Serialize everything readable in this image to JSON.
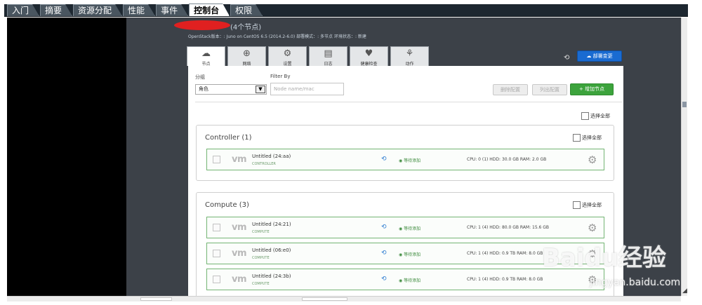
{
  "outer_tabs": [
    {
      "label": "入门"
    },
    {
      "label": "摘要"
    },
    {
      "label": "资源分配"
    },
    {
      "label": "性能"
    },
    {
      "label": "事件"
    },
    {
      "label": "控制台",
      "active": true
    },
    {
      "label": "权限"
    }
  ],
  "header": {
    "title_suffix": "(4个节点)",
    "info": "OpenStack版本：: Juno on CentOS 6.5 (2014.2-6.0)   部署模式：: 多节点   环境状态：: 新建",
    "deploy_button": "部署变更"
  },
  "icon_tabs": [
    {
      "label": "节点",
      "icon": "cloud-icon",
      "glyph": "☁",
      "active": true
    },
    {
      "label": "网络",
      "icon": "network-icon",
      "glyph": "⊕"
    },
    {
      "label": "设置",
      "icon": "gear-icon",
      "glyph": "⚙"
    },
    {
      "label": "日志",
      "icon": "document-icon",
      "glyph": "▤"
    },
    {
      "label": "健康检查",
      "icon": "heart-icon",
      "glyph": "♥"
    },
    {
      "label": "动作",
      "icon": "actions-icon",
      "glyph": "⚘"
    }
  ],
  "toolbar": {
    "group_label": "分组",
    "group_value": "角色",
    "filter_label": "Filter By",
    "filter_placeholder": "Node name/mac",
    "delete_button": "删除配置",
    "list_button": "列出配置",
    "add_button": "+ 增加节点",
    "select_all": "选择全部"
  },
  "groups": [
    {
      "title": "Controller (1)",
      "select_all": "选择全部",
      "nodes": [
        {
          "vm": "vm",
          "name": "Untitled (24:aa)",
          "role": "CONTROLLER",
          "status": "等待添加",
          "resources": "CPU: 0 (1)    HDD: 30.0 GB    RAM: 2.0 GB"
        }
      ]
    },
    {
      "title": "Compute (3)",
      "select_all": "选择全部",
      "nodes": [
        {
          "vm": "vm",
          "name": "Untitled (24:21)",
          "role": "COMPUTE",
          "status": "等待添加",
          "resources": "CPU: 1 (4)    HDD: 80.0 GB    RAM: 15.6 GB"
        },
        {
          "vm": "vm",
          "name": "Untitled (06:e0)",
          "role": "COMPUTE",
          "status": "等待添加",
          "resources": "CPU: 1 (4)    HDD: 0.9 TB    RAM: 8.0 GB"
        },
        {
          "vm": "vm",
          "name": "Untitled (24:3b)",
          "role": "COMPUTE",
          "status": "等待添加",
          "resources": "CPU: 1 (4)    HDD: 0.9 TB    RAM: 8.0 GB"
        }
      ]
    }
  ],
  "watermark": {
    "brand": "Baidu经验",
    "url": "jingyan.baidu.com"
  },
  "colors": {
    "accent_blue": "#1a6bd1",
    "accent_green": "#3ca33c",
    "node_border": "#74b574",
    "panel_bg": "#3c4148"
  }
}
